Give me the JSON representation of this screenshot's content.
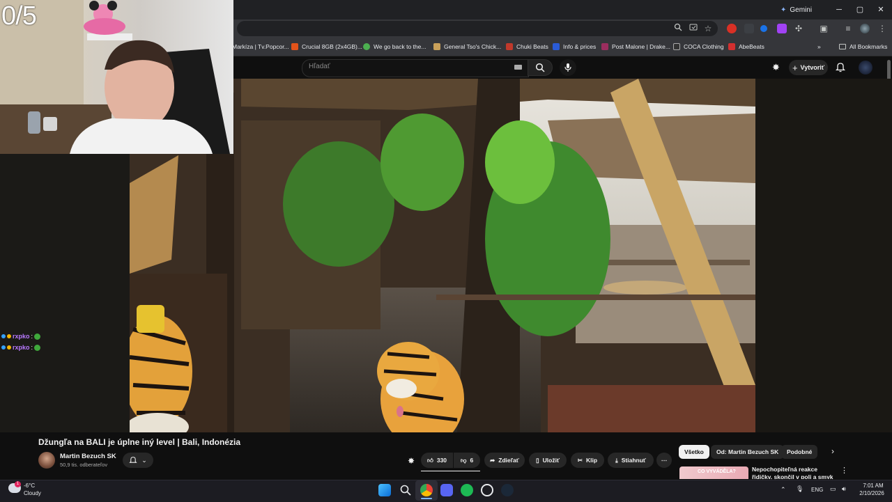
{
  "stream_overlay": {
    "counter": "0/5",
    "chat": [
      {
        "user": "rxpko",
        "separator": ":"
      },
      {
        "user": "rxpko",
        "separator": ":"
      }
    ]
  },
  "browser": {
    "gemini_label": "Gemini",
    "window_controls": {
      "minimize": "─",
      "maximize": "▢",
      "close": "✕"
    },
    "bookmarks": [
      {
        "label": "Markíza | Tv.Popcor...",
        "color": "#1f6fd6"
      },
      {
        "label": "Crucial 8GB (2x4GB)...",
        "color": "#e2531a"
      },
      {
        "label": "We go back to the...",
        "color": "#4caf50"
      },
      {
        "label": "General Tso's Chick...",
        "color": "#c9a15a"
      },
      {
        "label": "Chuki Beats",
        "color": "#c0392b"
      },
      {
        "label": "Info & prices",
        "color": "#2a5bd7"
      },
      {
        "label": "Post Malone | Drake...",
        "color": "#9b2d5e"
      },
      {
        "label": "COCA Clothing",
        "color": "#333333"
      },
      {
        "label": "AbeBeats",
        "color": "#d32f2f"
      }
    ],
    "all_bookmarks": "All Bookmarks"
  },
  "youtube": {
    "search_placeholder": "Hľadať",
    "create_label": "Vytvoriť",
    "video": {
      "title": "Džungľa na BALI je úplne iný level | Bali, Indonézia",
      "channel": "Martin Bezuch SK",
      "subscribers": "50,9 tis. odberateľov",
      "likes": "330",
      "dislikes": "6",
      "actions": {
        "share": "Zdieľať",
        "save": "Uložiť",
        "clip": "Klip",
        "download": "Stiahnuť"
      }
    },
    "chips": [
      "Všetko",
      "Od: Martin Bezuch SK",
      "Podobné"
    ],
    "recommendation": {
      "thumb_text": "CO VYVÁDĚLA?",
      "title": "Nepochopiteľná reakce řidičky, skončil v poli a smyk na ledovy..."
    }
  },
  "taskbar": {
    "weather_temp": "-6°C",
    "weather_desc": "Cloudy",
    "language": "ENG",
    "time": "7:01 AM",
    "date": "2/10/2026"
  }
}
